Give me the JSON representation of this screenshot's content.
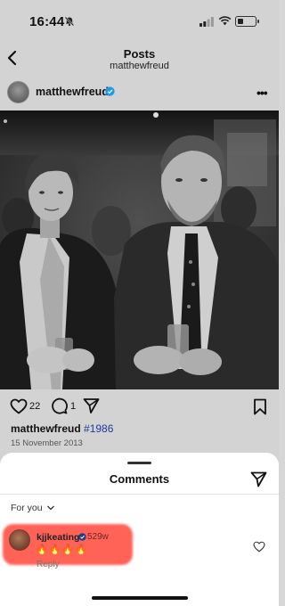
{
  "status_bar": {
    "time": "16:44"
  },
  "header": {
    "title": "Posts",
    "subtitle": "matthewfreud"
  },
  "post": {
    "username": "matthewfreud",
    "likes": "22",
    "comments": "1",
    "caption_user": "matthewfreud",
    "caption_tag": "#1986",
    "date": "15 November 2013"
  },
  "comments_sheet": {
    "title": "Comments",
    "filter_label": "For you",
    "comment": {
      "user": "kjjkeating",
      "time": "529w",
      "text": "🔥🔥🔥🔥",
      "reply_label": "Reply"
    }
  },
  "colors": {
    "verified": "#1d9bf0",
    "highlight": "#ff5a4f",
    "link": "#1e3aa0"
  },
  "icons": [
    "muted-bell-icon",
    "signal-icon",
    "wifi-icon",
    "battery-icon",
    "back-chevron-icon",
    "verified-badge-icon",
    "more-icon",
    "heart-icon",
    "comment-icon",
    "share-icon",
    "bookmark-icon",
    "send-icon",
    "chevron-down-icon"
  ]
}
